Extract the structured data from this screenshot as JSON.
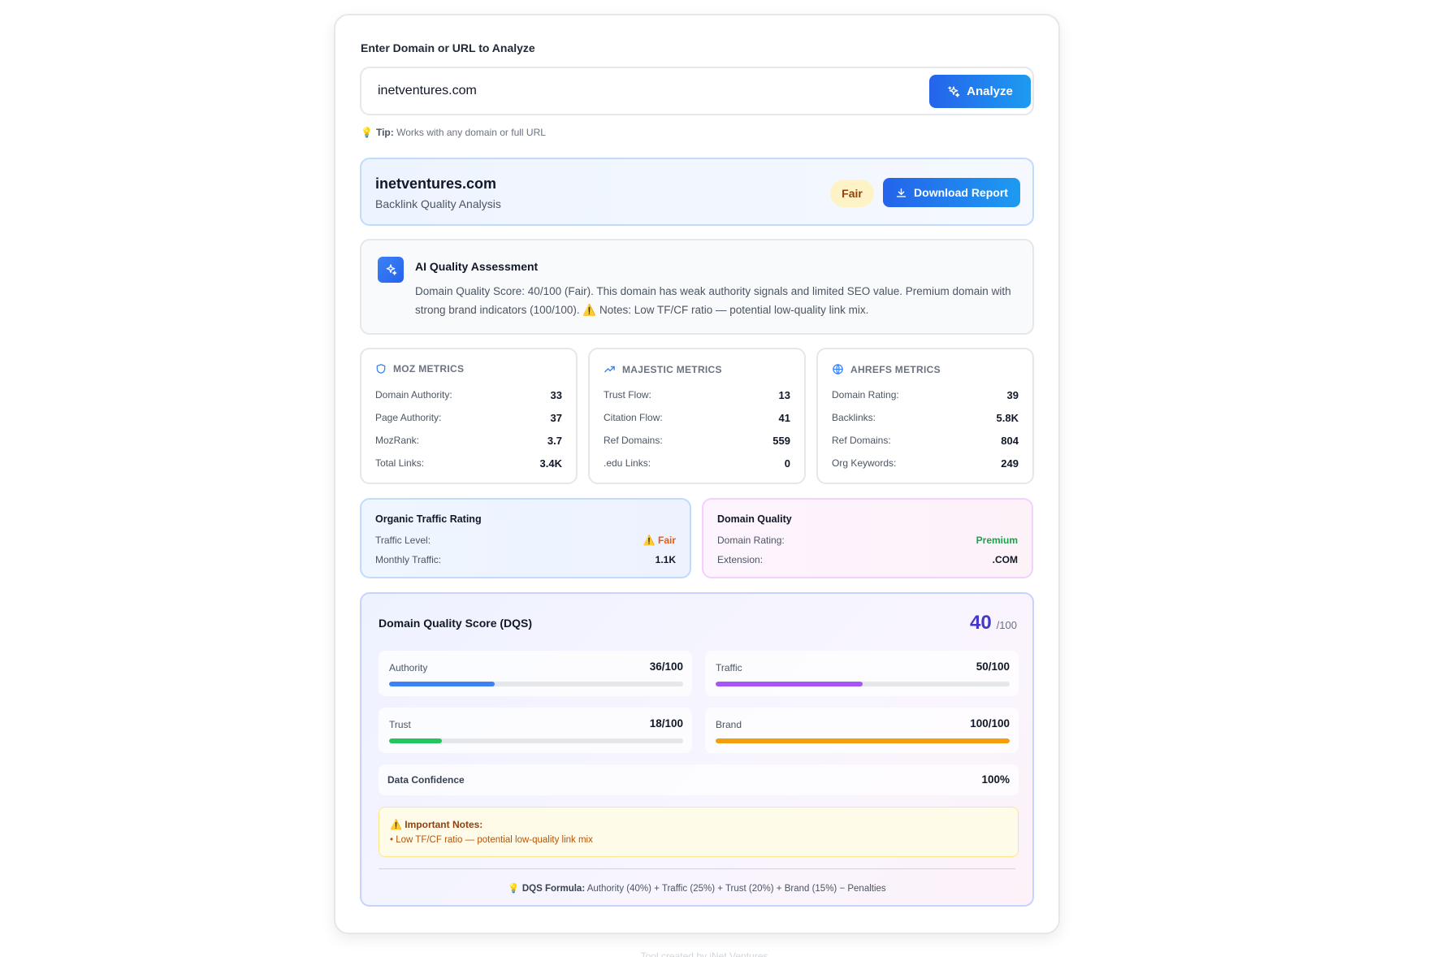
{
  "input": {
    "label": "Enter Domain or URL to Analyze",
    "value": "inetventures.com",
    "analyze_label": "Analyze",
    "tip_bold": "Tip:",
    "tip_text": "Works with any domain or full URL"
  },
  "result_header": {
    "domain": "inetventures.com",
    "subtitle": "Backlink Quality Analysis",
    "badge": "Fair",
    "download_label": "Download Report"
  },
  "ai_assessment": {
    "title": "AI Quality Assessment",
    "text_main": "Domain Quality Score: 40/100 (Fair). This domain has weak authority signals and limited SEO value. Premium domain with strong brand indicators (100/100).",
    "text_note": "Notes: Low TF/CF ratio — potential low-quality link mix."
  },
  "metrics": {
    "moz": {
      "title": "MOZ METRICS",
      "rows": [
        {
          "label": "Domain Authority:",
          "value": "33"
        },
        {
          "label": "Page Authority:",
          "value": "37"
        },
        {
          "label": "MozRank:",
          "value": "3.7"
        },
        {
          "label": "Total Links:",
          "value": "3.4K"
        }
      ]
    },
    "majestic": {
      "title": "MAJESTIC METRICS",
      "rows": [
        {
          "label": "Trust Flow:",
          "value": "13"
        },
        {
          "label": "Citation Flow:",
          "value": "41"
        },
        {
          "label": "Ref Domains:",
          "value": "559"
        },
        {
          "label": ".edu Links:",
          "value": "0"
        }
      ]
    },
    "ahrefs": {
      "title": "AHREFS METRICS",
      "rows": [
        {
          "label": "Domain Rating:",
          "value": "39"
        },
        {
          "label": "Backlinks:",
          "value": "5.8K"
        },
        {
          "label": "Ref Domains:",
          "value": "804"
        },
        {
          "label": "Org Keywords:",
          "value": "249"
        }
      ]
    }
  },
  "organic_traffic": {
    "title": "Organic Traffic Rating",
    "rows": [
      {
        "label": "Traffic Level:",
        "value": "Fair"
      },
      {
        "label": "Monthly Traffic:",
        "value": "1.1K"
      }
    ]
  },
  "domain_quality": {
    "title": "Domain Quality",
    "rows": [
      {
        "label": "Domain Rating:",
        "value": "Premium"
      },
      {
        "label": "Extension:",
        "value": ".COM"
      }
    ]
  },
  "dqs": {
    "title": "Domain Quality Score (DQS)",
    "score": "40",
    "max": "/100",
    "components": [
      {
        "label": "Authority",
        "value": "36/100",
        "percent": 36,
        "color": "#3b82f6"
      },
      {
        "label": "Traffic",
        "value": "50/100",
        "percent": 50,
        "color": "#a855f7"
      },
      {
        "label": "Trust",
        "value": "18/100",
        "percent": 18,
        "color": "#22c55e"
      },
      {
        "label": "Brand",
        "value": "100/100",
        "percent": 100,
        "color": "#f59e0b"
      }
    ],
    "confidence_label": "Data Confidence",
    "confidence_value": "100%",
    "notes_title": "Important Notes:",
    "notes_item": "• Low TF/CF ratio — potential low-quality link mix",
    "formula_bold": "DQS Formula:",
    "formula_text": "Authority (40%) + Traffic (25%) + Trust (20%) + Brand (15%) − Penalties"
  },
  "footer": "Tool created by iNet Ventures",
  "colors": {
    "primary": "#2563eb",
    "fair_badge_bg": "#fef3c7",
    "traffic_fair": "#ea580c",
    "premium": "#16a34a",
    "dqs_score": "#4338ca"
  }
}
